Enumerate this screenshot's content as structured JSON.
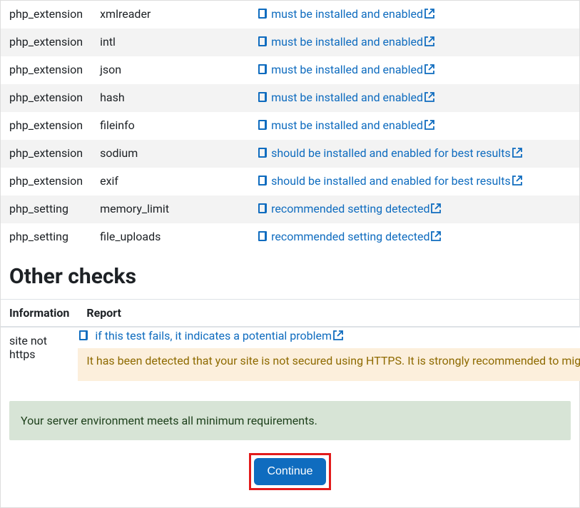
{
  "checks": [
    {
      "type": "php_extension",
      "name": "xmlreader",
      "status": "must be installed and enabled"
    },
    {
      "type": "php_extension",
      "name": "intl",
      "status": "must be installed and enabled"
    },
    {
      "type": "php_extension",
      "name": "json",
      "status": "must be installed and enabled"
    },
    {
      "type": "php_extension",
      "name": "hash",
      "status": "must be installed and enabled"
    },
    {
      "type": "php_extension",
      "name": "fileinfo",
      "status": "must be installed and enabled"
    },
    {
      "type": "php_extension",
      "name": "sodium",
      "status": "should be installed and enabled for best results"
    },
    {
      "type": "php_extension",
      "name": "exif",
      "status": "should be installed and enabled for best results"
    },
    {
      "type": "php_setting",
      "name": "memory_limit",
      "status": "recommended setting detected"
    },
    {
      "type": "php_setting",
      "name": "file_uploads",
      "status": "recommended setting detected"
    }
  ],
  "other_heading": "Other checks",
  "other_headers": {
    "col1": "Information",
    "col2": "Report"
  },
  "other_row": {
    "info": "site not https",
    "link_text": "if this test fails, it indicates a potential problem",
    "message": "It has been detected that your site is not secured using HTTPS. It is strongly recommended to migrate your site to HTTPS for increased security and improved integration with other systems."
  },
  "success_message": "Your server environment meets all minimum requirements.",
  "continue_label": "Continue"
}
